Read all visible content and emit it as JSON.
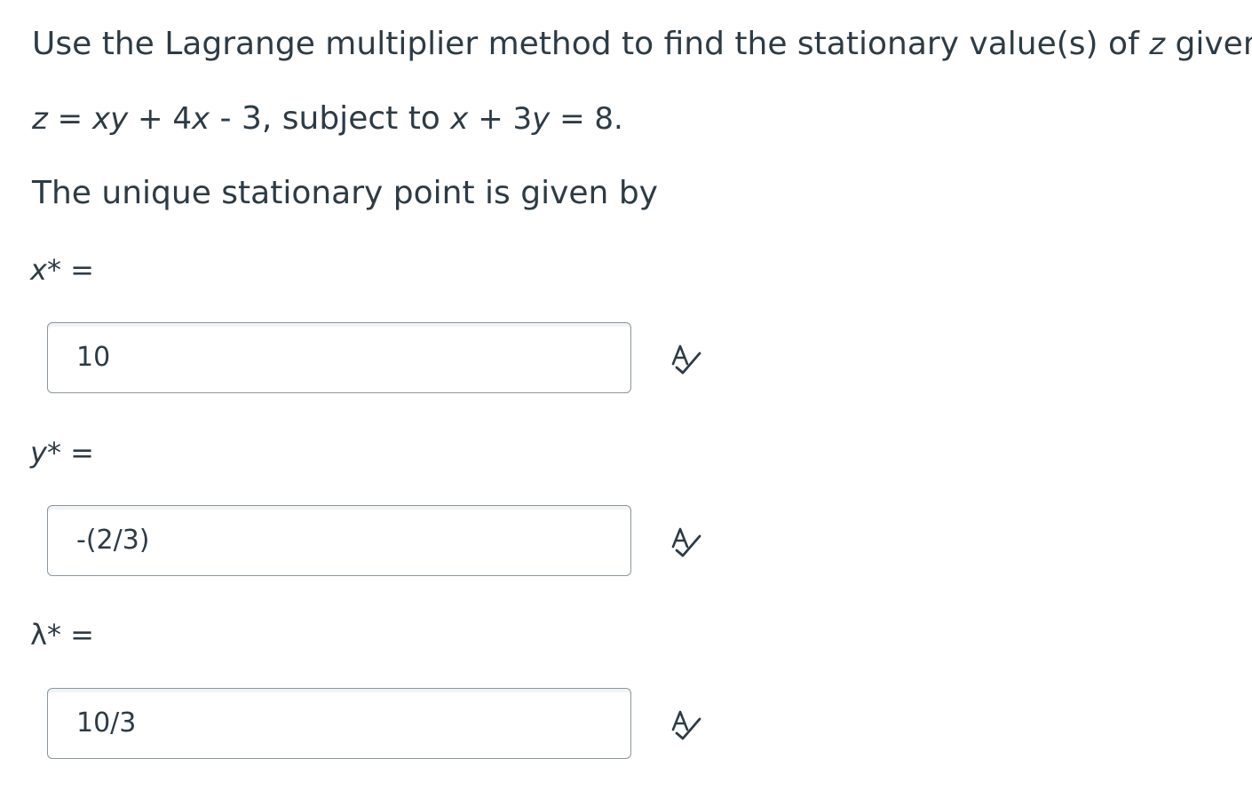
{
  "question": {
    "intro_text": "Use the Lagrange multiplier method to find the stationary value(s) of ",
    "intro_var": "z",
    "intro_end": " given by",
    "equation": {
      "z": "z",
      "eq1": " = ",
      "xy": "xy",
      "mid1": " + 4",
      "x1": "x",
      "mid2": " - 3, subject to ",
      "x2": "x",
      "mid3": " + 3",
      "y": "y",
      "end": " = 8."
    },
    "subheading": "The unique stationary point is given by"
  },
  "answers": [
    {
      "var": "x",
      "suffix": "*  =",
      "value": "10",
      "icon": "spellcheck-icon"
    },
    {
      "var": "y",
      "suffix": "* =",
      "value": "-(2/3)",
      "icon": "spellcheck-icon"
    },
    {
      "var": "λ",
      "suffix": "*  =",
      "value": "10/3",
      "icon": "spellcheck-icon"
    }
  ],
  "colors": {
    "text": "#2d3b45",
    "border": "#8b969e"
  }
}
